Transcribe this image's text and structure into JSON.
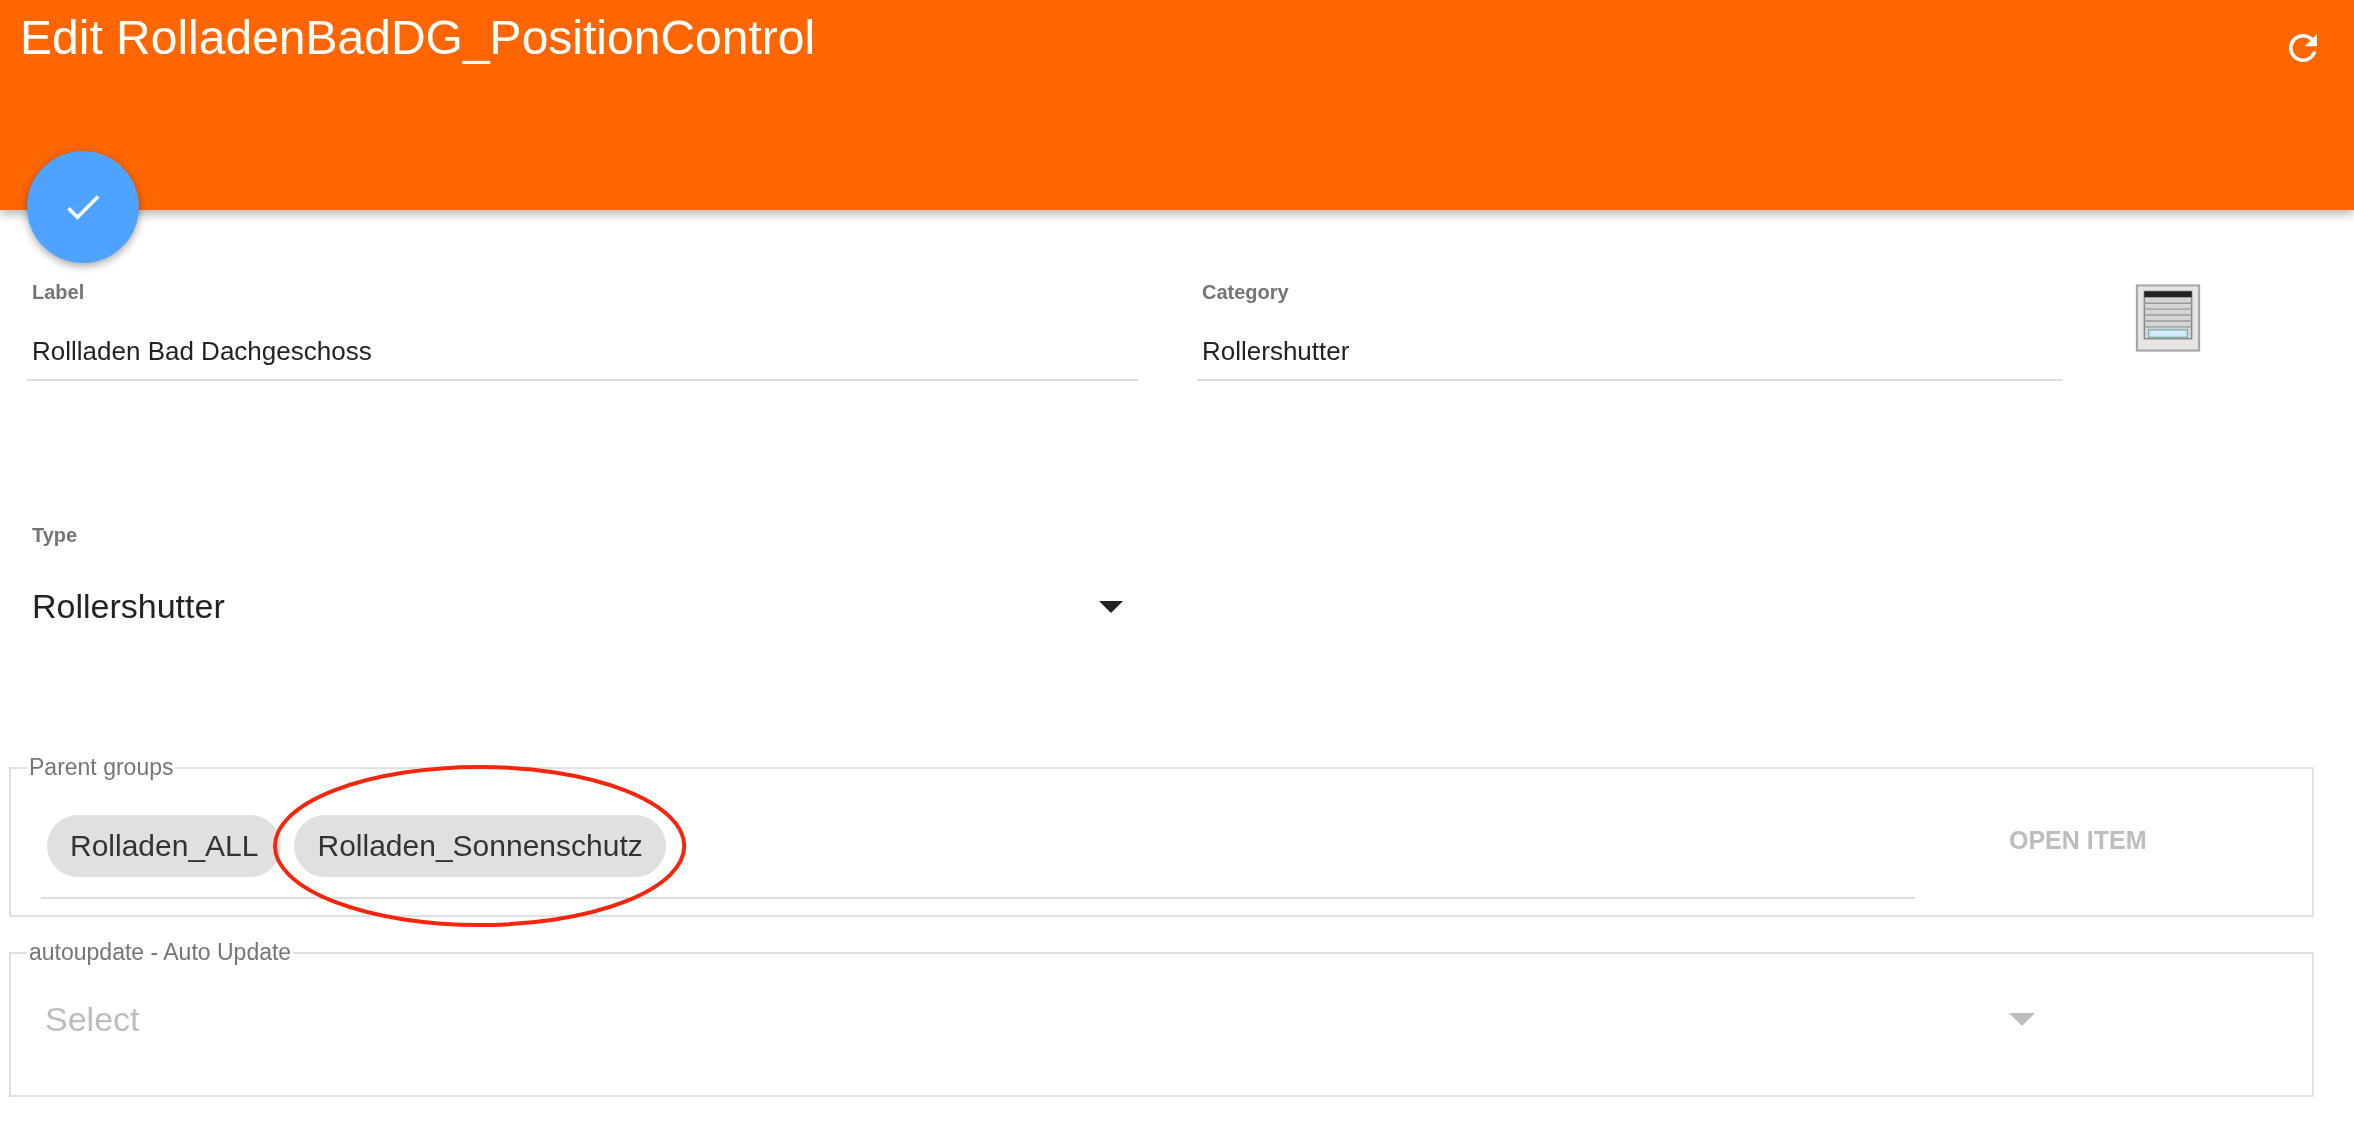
{
  "header": {
    "title": "Edit RolladenBadDG_PositionControl",
    "refresh_icon": true
  },
  "fields": [
    {
      "label": "Label",
      "value": "Rollladen Bad Dachgeschoss"
    },
    {
      "label": "Category",
      "value": "Rollershutter",
      "has_icon": true
    }
  ],
  "type_select": {
    "label": "Type",
    "value": "Rollershutter"
  },
  "parent_groups": {
    "legend": "Parent groups",
    "chips": [
      {
        "label": "Rolladen_ALL",
        "highlighted": false
      },
      {
        "label": "Rolladen_Sonnenschutz",
        "highlighted": true
      }
    ],
    "button": {
      "label": "OPEN ITEM",
      "disabled": true
    }
  },
  "autoupdate": {
    "legend": "autoupdate - Auto Update",
    "placeholder": "Select"
  }
}
